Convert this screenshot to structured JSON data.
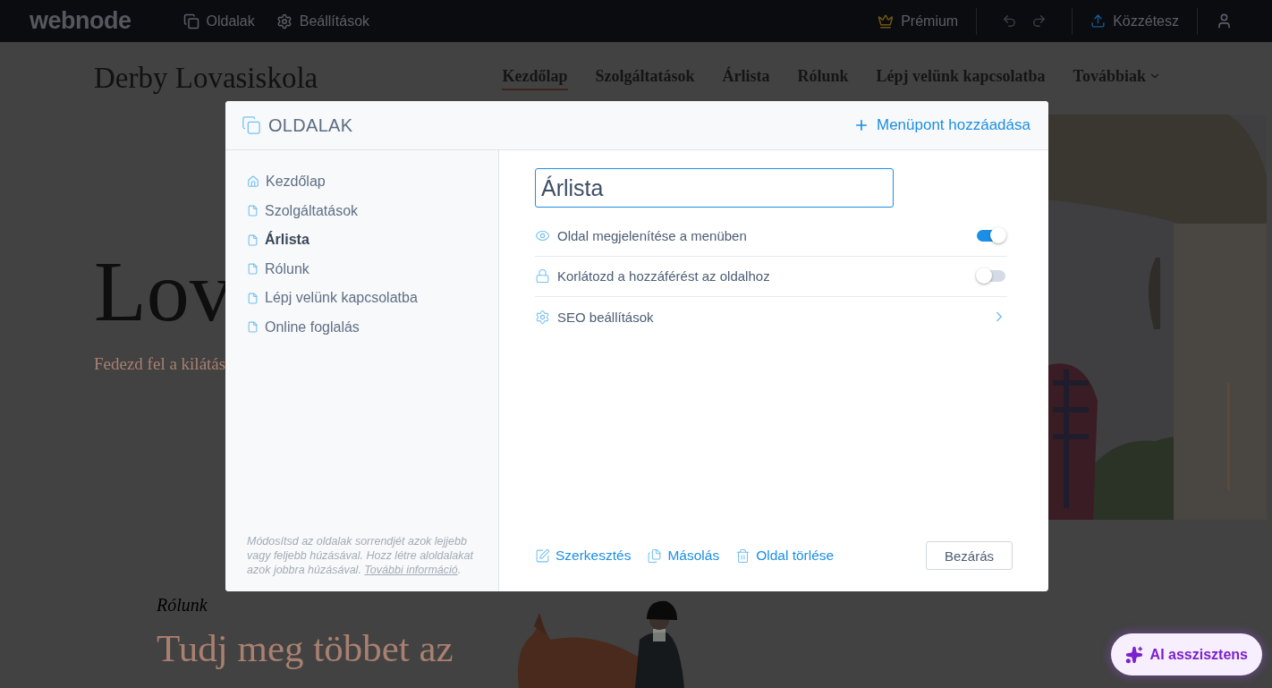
{
  "topbar": {
    "logo": "webnode",
    "items": [
      {
        "label": "Oldalak",
        "kind": "pages"
      },
      {
        "label": "Beállítások",
        "kind": "settings"
      }
    ],
    "premium": "Prémium",
    "publish": "Közzétesz"
  },
  "site": {
    "title": "Derby Lovasiskola",
    "nav": [
      {
        "label": "Kezdőlap",
        "selected": true,
        "dropdown": false
      },
      {
        "label": "Szolgáltatások",
        "selected": false,
        "dropdown": false
      },
      {
        "label": "Árlista",
        "selected": false,
        "dropdown": false
      },
      {
        "label": "Rólunk",
        "selected": false,
        "dropdown": false
      },
      {
        "label": "Lépj velünk kapcsolatba",
        "selected": false,
        "dropdown": false
      },
      {
        "label": "Továbbiak",
        "selected": false,
        "dropdown": true
      }
    ]
  },
  "hero": {
    "heading": "Lov",
    "subheading": "Fedezd fel a kilátás"
  },
  "about": {
    "eyebrow": "Rólunk",
    "heading": "Tudj meg többet az"
  },
  "ai_button": "AI asszisztens",
  "dialog": {
    "title": "OLDALAK",
    "add_button": "Menüpont hozzáadása",
    "pages": [
      {
        "label": "Kezdőlap",
        "kind": "home",
        "selected": false
      },
      {
        "label": "Szolgáltatások",
        "kind": "page",
        "selected": false
      },
      {
        "label": "Árlista",
        "kind": "page",
        "selected": true
      },
      {
        "label": "Rólunk",
        "kind": "page",
        "selected": false
      },
      {
        "label": "Lépj velünk kapcsolatba",
        "kind": "page",
        "selected": false
      },
      {
        "label": "Online foglalás",
        "kind": "page",
        "selected": false
      }
    ],
    "hint": "Módosítsd az oldalak sorrendjét azok lejjebb vagy feljebb húzásával. Hozz létre aloldalakat azok jobbra húzásával.",
    "hint_link": "További információ",
    "hint_end": ".",
    "name_value": "Árlista",
    "options": [
      {
        "kind": "toggle",
        "label": "Oldal megjelenítése a menüben",
        "on": true
      },
      {
        "kind": "toggle",
        "label": "Korlátozd a hozzáférést az oldalhoz",
        "on": false
      },
      {
        "kind": "link",
        "label": "SEO beállítások"
      }
    ],
    "actions": [
      {
        "label": "Szerkesztés"
      },
      {
        "label": "Másolás"
      },
      {
        "label": "Oldal törlése"
      }
    ],
    "close_button": "Bezárás"
  }
}
